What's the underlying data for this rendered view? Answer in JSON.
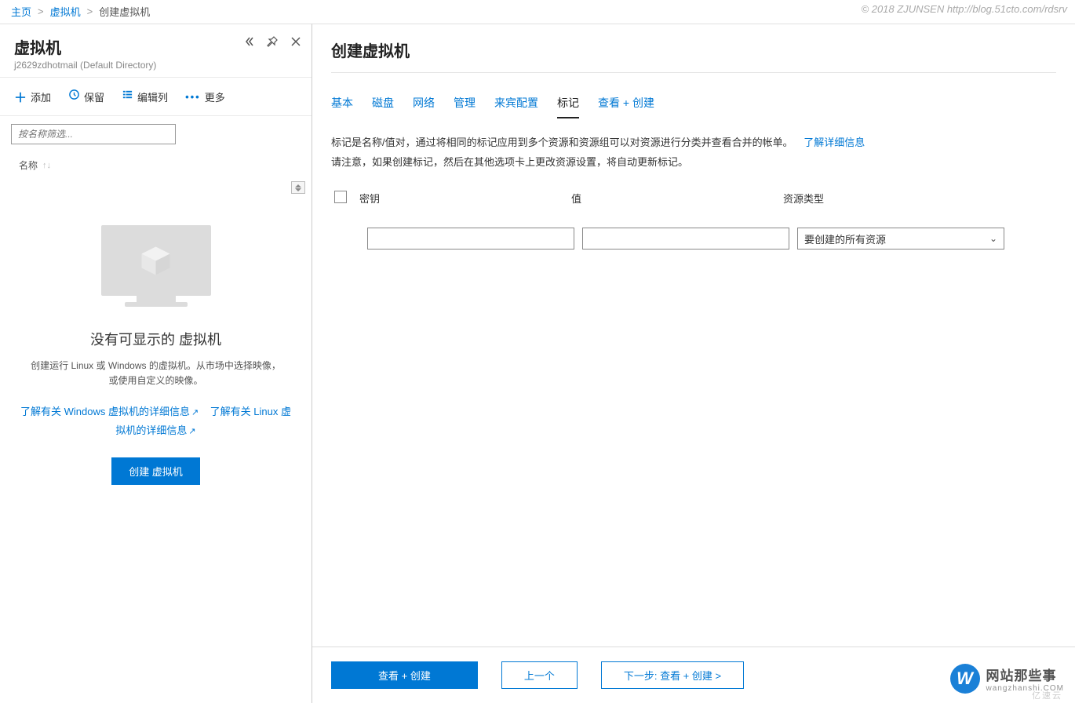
{
  "watermark": "© 2018 ZJUNSEN http://blog.51cto.com/rdsrv",
  "breadcrumb": {
    "home": "主页",
    "vm": "虚拟机",
    "create": "创建虚拟机"
  },
  "left": {
    "title": "虚拟机",
    "subtitle": "j2629zdhotmail (Default Directory)",
    "toolbar": {
      "add": "添加",
      "reserve": "保留",
      "edit_cols": "编辑列",
      "more": "更多"
    },
    "filter_placeholder": "按名称筛选...",
    "col_name": "名称",
    "empty": {
      "heading": "没有可显示的 虚拟机",
      "body": "创建运行 Linux 或 Windows 的虚拟机。从市场中选择映像，或使用自定义的映像。",
      "link_windows": "了解有关 Windows 虚拟机的详细信息",
      "link_linux": "了解有关 Linux 虚拟机的详细信息",
      "create_btn": "创建 虚拟机"
    }
  },
  "right": {
    "title": "创建虚拟机",
    "tabs": {
      "basic": "基本",
      "disk": "磁盘",
      "network": "网络",
      "manage": "管理",
      "guest": "来宾配置",
      "tags": "标记",
      "review": "查看 + 创建"
    },
    "active_tab": "tags",
    "desc_line1_a": "标记是名称/值对，通过将相同的标记应用到多个资源和资源组可以对资源进行分类并查看合并的帐单。",
    "desc_link": "了解详细信息",
    "desc_line2": "请注意，如果创建标记，然后在其他选项卡上更改资源设置，将自动更新标记。",
    "tag_table": {
      "hdr_key": "密钥",
      "hdr_val": "值",
      "hdr_type": "资源类型",
      "type_default": "要创建的所有资源"
    },
    "footer": {
      "review": "查看 + 创建",
      "prev": "上一个",
      "next": "下一步: 查看 + 创建 >"
    }
  },
  "logo": {
    "letter": "W",
    "line1": "网站那些事",
    "line2": "wangzhanshi.COM",
    "yisu": "亿速云"
  }
}
